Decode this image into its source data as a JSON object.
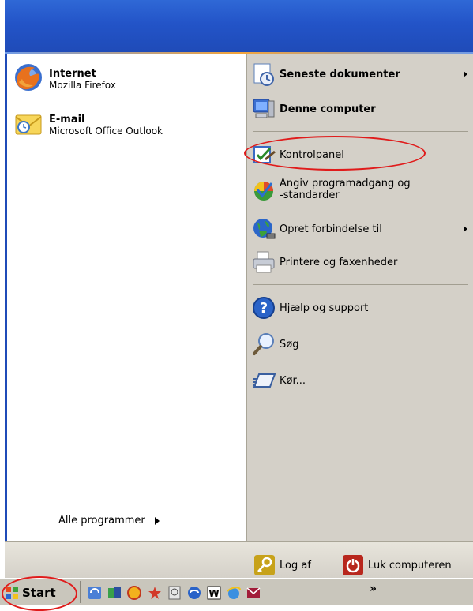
{
  "left": {
    "pinned": [
      {
        "title": "Internet",
        "sub": "Mozilla Firefox"
      },
      {
        "title": "E-mail",
        "sub": "Microsoft Office Outlook"
      }
    ],
    "all_programs": "Alle programmer"
  },
  "right": {
    "items": [
      {
        "label": "Seneste dokumenter"
      },
      {
        "label": "Denne computer"
      },
      {
        "label": "Kontrolpanel"
      },
      {
        "label": "Angiv programadgang og\n-standarder"
      },
      {
        "label": "Opret forbindelse til"
      },
      {
        "label": "Printere og faxenheder"
      },
      {
        "label": "Hjælp og support"
      },
      {
        "label": "Søg"
      },
      {
        "label": "Kør..."
      }
    ]
  },
  "footer": {
    "logoff": "Log af",
    "shutdown": "Luk computeren"
  },
  "taskbar": {
    "start": "Start",
    "overflow": "»"
  },
  "colors": {
    "header": "#2354c8",
    "panel": "#d4d0c8",
    "highlight": "#e01b1b"
  }
}
